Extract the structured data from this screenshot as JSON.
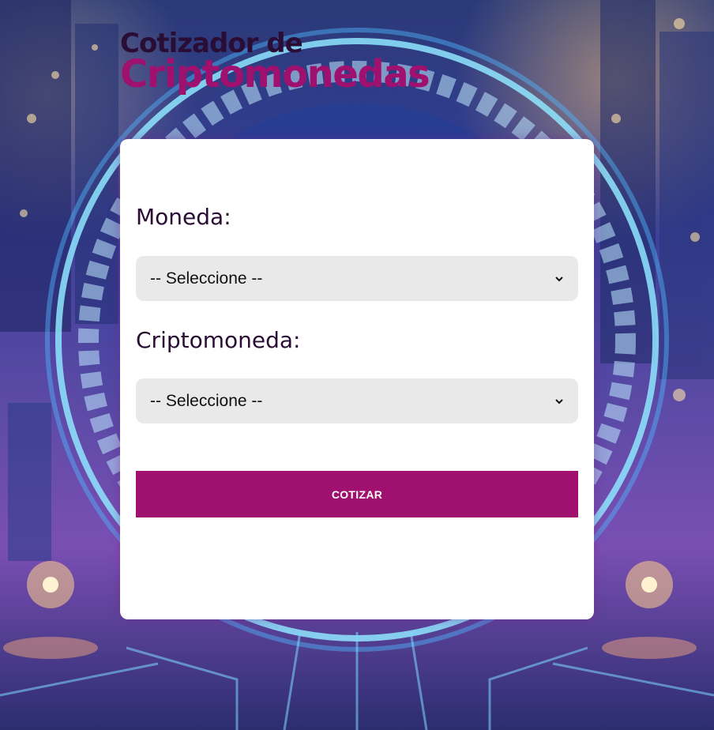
{
  "header": {
    "title_line1": "Cotizador de",
    "title_line2": "Criptomonedas"
  },
  "form": {
    "currency_label": "Moneda:",
    "currency_select_value": "-- Seleccione --",
    "crypto_label": "Criptomoneda:",
    "crypto_select_value": "-- Seleccione --",
    "submit_label": "COTIZAR"
  },
  "colors": {
    "accent": "#a0106e",
    "title_dark": "#2a0d34",
    "select_bg": "#e9e9e9",
    "card_bg": "#ffffff"
  },
  "icons": {
    "select_arrow": "chevron-down-icon"
  }
}
